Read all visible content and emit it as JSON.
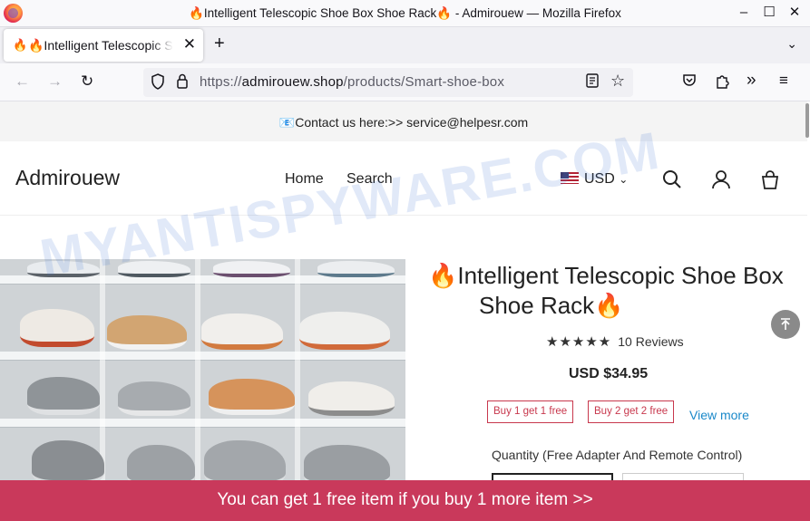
{
  "browser": {
    "window_title": "🔥Intelligent Telescopic Shoe Box Shoe Rack🔥 - Admirouew — Mozilla Firefox",
    "tab_title": "🔥Intelligent Telescopic Shoe Box Shoe Rack🔥",
    "tab_favicon": "🔥",
    "new_tab_glyph": "+",
    "url_host": "admirouew.shop",
    "url_prefix": "https://",
    "url_path": "/products/Smart-shoe-box"
  },
  "store": {
    "contact_text": "📧Contact us here:>> service@helpesr.com",
    "brand": "Admirouew",
    "menu": [
      "Home",
      "Search"
    ],
    "currency": "USD"
  },
  "product": {
    "title_line1": "🔥Intelligent Telescopic Shoe Box",
    "title_line2": "Shoe Rack🔥",
    "stars": "★★★★★",
    "reviews": "10 Reviews",
    "price": "USD $34.95",
    "offers": [
      "Buy 1 get 1 free",
      "Buy 2 get 2 free"
    ],
    "view_more": "View more",
    "quantity_label": "Quantity (Free Adapter And Remote Control)"
  },
  "promo": {
    "text": "You can get 1 free item if you buy 1 more item  >>"
  },
  "watermark": "MYANTISPYWARE.COM",
  "colors": {
    "promo_bar": "#c9395b",
    "offer_badge": "#c8384d",
    "link": "#1a88c9"
  },
  "icons": {
    "back": "arrow-left-icon",
    "forward": "arrow-right-icon",
    "reload": "reload-icon",
    "shield": "tracking-protection-icon",
    "lock": "lock-icon",
    "reader": "reader-view-icon",
    "bookmark": "star-icon",
    "pocket": "pocket-icon",
    "extensions": "extensions-icon",
    "overflow": "chevron-double-right-icon",
    "menu": "hamburger-icon"
  }
}
